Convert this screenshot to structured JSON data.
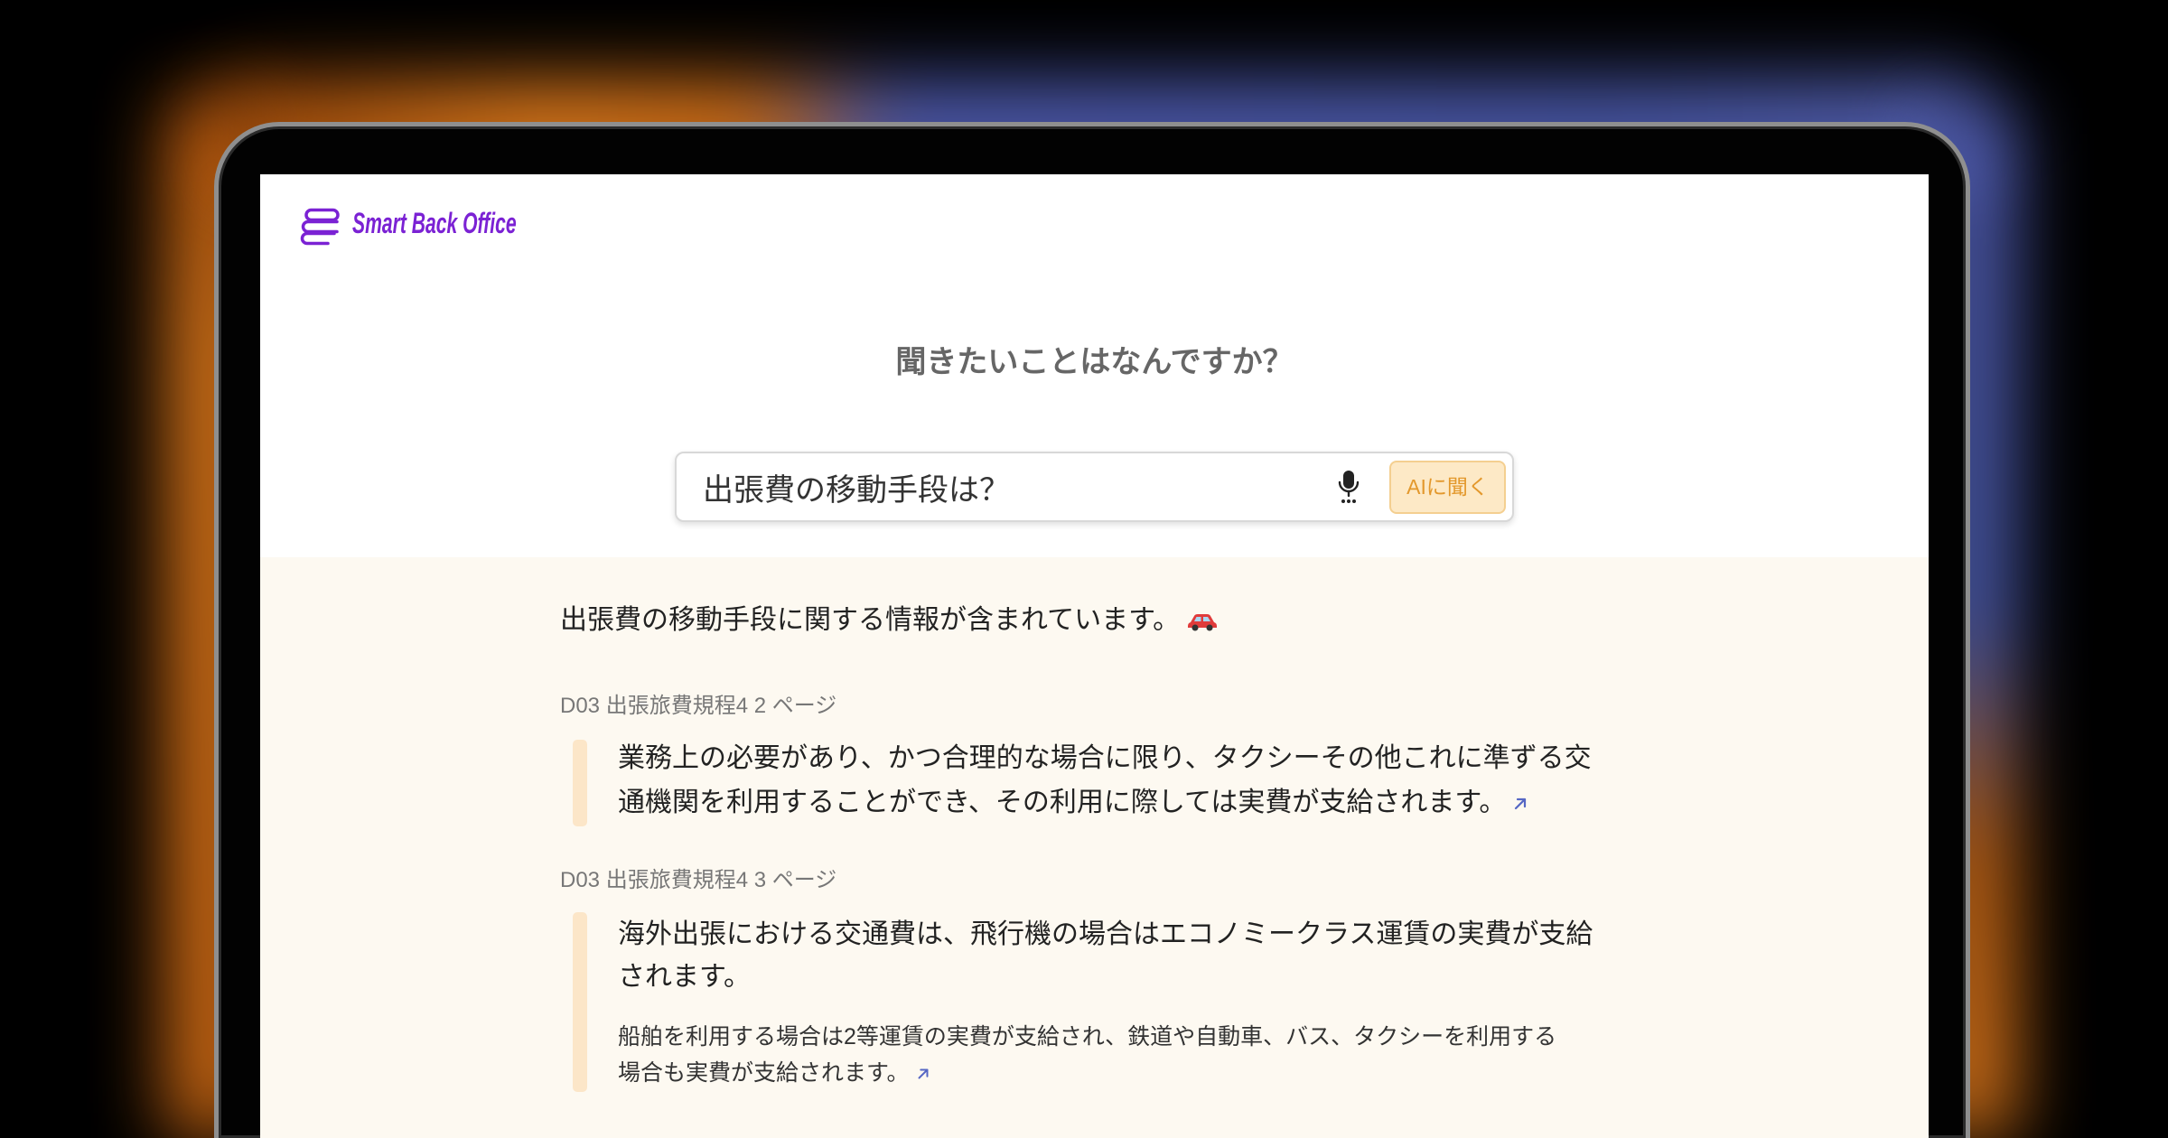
{
  "brand": {
    "logo_text": "Smart Back Office",
    "logo_icon": "stacked-layers-icon",
    "color": "#7b22d4"
  },
  "hero": {
    "heading": "聞きたいことはなんですか？"
  },
  "search": {
    "value": "出張費の移動手段は？",
    "mic_icon": "microphone-icon",
    "ask_button_label": "AIに聞く"
  },
  "answer": {
    "summary": "出張費の移動手段に関する情報が含まれています。",
    "summary_emoji_icon": "car-icon",
    "sources": [
      {
        "title": "D03 出張旅費規程4 2 ページ",
        "excerpt_lines": [
          "業務上の必要があり、かつ合理的な場合に限り、タクシーその他これに準ずる交",
          "通機関を利用することができ、その利用に際しては実費が支給されます。"
        ],
        "link_icon": "external-link-icon"
      },
      {
        "title": "D03 出張旅費規程4 3 ページ",
        "excerpt_lines": [
          "海外出張における交通費は、飛行機の場合はエコノミークラス運賃の実費が支給",
          "されます。"
        ],
        "detail_lines": [
          "船舶を利用する場合は2等運賃の実費が支給され、鉄道や自動車、バス、タクシーを利用する",
          "場合も実費が支給されます。"
        ],
        "link_icon": "external-link-icon"
      }
    ]
  },
  "colors": {
    "page_background": "#000000",
    "screen_background": "#ffffff",
    "answer_background": "#fdf9f1",
    "quote_bar": "#fce6c8",
    "ask_button_background": "#fde9c6",
    "ask_button_text": "#e3982c",
    "link": "#5667c4",
    "glow_orange": "#ff8a1e",
    "glow_blue": "#5a68c8"
  }
}
